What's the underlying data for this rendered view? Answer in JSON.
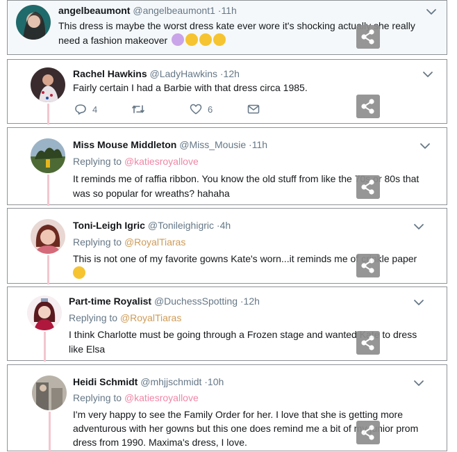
{
  "tweets": [
    {
      "name": "angelbeaumont",
      "handle": "@angelbeaumont1",
      "time": "·11h",
      "replying_label": "",
      "replying_to": "",
      "text": "This dress is maybe the worst dress kate ever wore it's shocking actually she really need a fashion makeover",
      "emoji": [
        "woman-facepalming-emoji",
        "face-screaming-emoji",
        "face-screaming-emoji",
        "face-screaming-emoji"
      ]
    },
    {
      "name": "Rachel Hawkins",
      "handle": "@LadyHawkins",
      "time": "·12h",
      "replying_label": "",
      "replying_to": "",
      "text": "Fairly certain I had a Barbie with that dress circa 1985.",
      "reply_count": "4",
      "retweet_count": "",
      "like_count": "6"
    },
    {
      "name": "Miss Mouse Middleton",
      "handle": "@Miss_Mousie",
      "time": "·11h",
      "replying_label": "Replying to",
      "replying_to": "@katiesroyallove",
      "text": "It reminds me of raffia ribbon. You know the old stuff from like the 70s or 80s that was so popular for wreaths? hahaha"
    },
    {
      "name": "Toni-Leigh Igric",
      "handle": "@Tonileighigric",
      "time": "·4h",
      "replying_label": "Replying to",
      "replying_to": "@RoyalTiaras",
      "text": "This is not one of my favorite gowns Kate's worn...it reminds me of crinkle paper",
      "emoji": [
        "relieved-face-emoji"
      ]
    },
    {
      "name": "Part-time Royalist",
      "handle": "@DuchessSpotting",
      "time": "·12h",
      "replying_label": "Replying to",
      "replying_to": "@RoyalTiaras",
      "text": "I think Charlotte must be going through a Frozen stage and wanted Kate to dress like Elsa"
    },
    {
      "name": "Heidi Schmidt",
      "handle": "@mhjjschmidt",
      "time": "·10h",
      "replying_label": "Replying to",
      "replying_to": "@katiesroyallove",
      "text": "I'm very happy to see the Family Order for her.  I love that she is getting more adventurous with her gowns but this one does remind me a bit of my junior prom dress from 1990. Maxima's dress, I love."
    }
  ],
  "colors": {
    "text": "#14171a",
    "muted": "#657786",
    "border": "#8e9296",
    "thread": "#f3c6cf",
    "share_overlay": "#8e8e8e"
  }
}
